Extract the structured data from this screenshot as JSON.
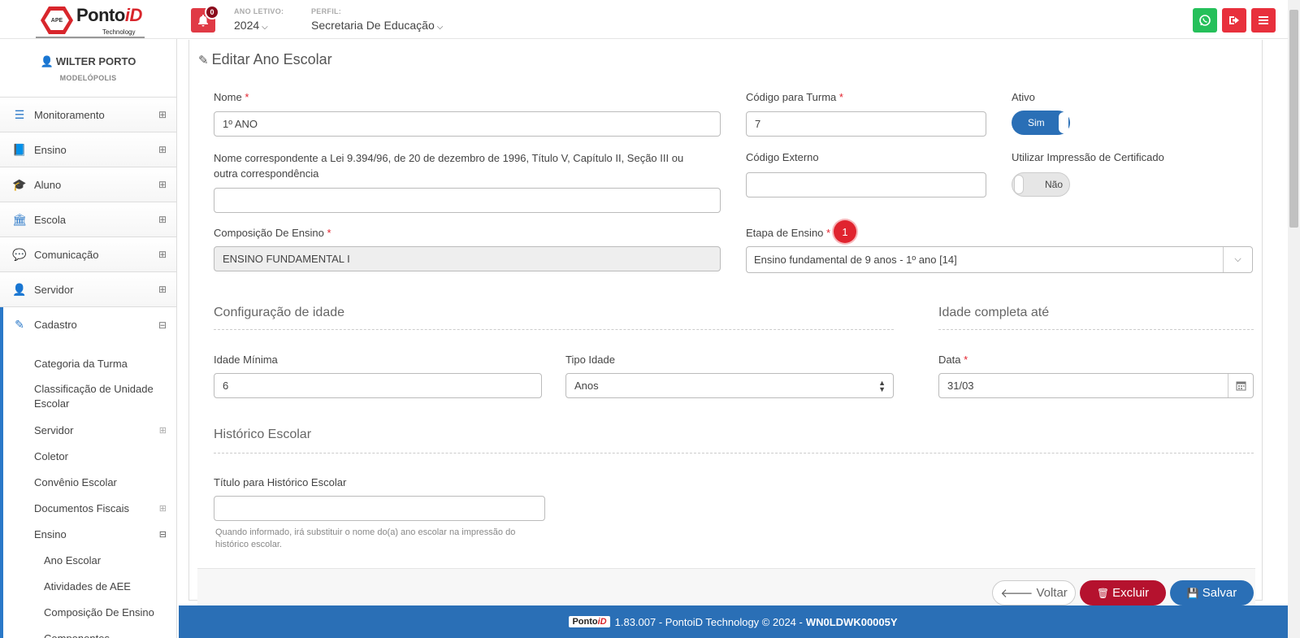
{
  "header": {
    "logo_text": "PontoiD",
    "logo_sub": "Technology",
    "logo_badge": "APE",
    "notifications_count": "0",
    "ano_letivo_label": "ANO LETIVO:",
    "ano_letivo_value": "2024",
    "perfil_label": "PERFIL:",
    "perfil_value": "Secretaria De Educação"
  },
  "user": {
    "name": "WILTER PORTO",
    "city": "MODELÓPOLIS"
  },
  "sidebar": {
    "items": [
      {
        "label": "Monitoramento"
      },
      {
        "label": "Ensino"
      },
      {
        "label": "Aluno"
      },
      {
        "label": "Escola"
      },
      {
        "label": "Comunicação"
      },
      {
        "label": "Servidor"
      },
      {
        "label": "Cadastro"
      }
    ],
    "sub_items": [
      {
        "label": "Categoria da Turma"
      },
      {
        "label": "Classificação de Unidade Escolar"
      },
      {
        "label": "Servidor"
      },
      {
        "label": "Coletor"
      },
      {
        "label": "Convênio Escolar"
      },
      {
        "label": "Documentos Fiscais"
      },
      {
        "label": "Ensino"
      }
    ],
    "deep_items": [
      {
        "label": "Ano Escolar"
      },
      {
        "label": "Atividades de AEE"
      },
      {
        "label": "Composição De Ensino"
      },
      {
        "label": "Componentes"
      }
    ]
  },
  "form": {
    "title": "Editar Ano Escolar",
    "nome_label": "Nome",
    "nome_value": "1º ANO",
    "codigo_turma_label": "Código para Turma",
    "codigo_turma_value": "7",
    "ativo_label": "Ativo",
    "ativo_value": "Sim",
    "nome_lei_label": "Nome correspondente a Lei 9.394/96, de 20 de dezembro de 1996, Título V, Capítulo II, Seção III ou outra correspondência",
    "nome_lei_value": "",
    "codigo_externo_label": "Código Externo",
    "codigo_externo_value": "",
    "certificado_label": "Utilizar Impressão de Certificado",
    "certificado_value": "Não",
    "composicao_label": "Composição De Ensino",
    "composicao_value": "ENSINO FUNDAMENTAL I",
    "etapa_label": "Etapa de Ensino",
    "etapa_badge": "1",
    "etapa_value": "Ensino fundamental de 9 anos - 1º ano [14]",
    "config_idade_title": "Configuração de idade",
    "idade_completa_title": "Idade completa até",
    "idade_minima_label": "Idade Mínima",
    "idade_minima_value": "6",
    "tipo_idade_label": "Tipo Idade",
    "tipo_idade_value": "Anos",
    "data_label": "Data",
    "data_value": "31/03",
    "historico_title": "Histórico Escolar",
    "titulo_historico_label": "Título para Histórico Escolar",
    "titulo_historico_value": "",
    "historico_hint": "Quando informado, irá substituir o nome do(a) ano escolar na impressão do histórico escolar.",
    "required_mark": "*"
  },
  "actions": {
    "voltar": "Voltar",
    "excluir": "Excluir",
    "salvar": "Salvar"
  },
  "footer": {
    "version_text": "1.83.007 - PontoiD Technology © 2024 -",
    "device_code": "WN0LDWK00005Y"
  },
  "colors": {
    "primary": "#2a6fb6",
    "danger": "#b5122e",
    "whatsapp": "#25c05a",
    "red_button": "#e8303c"
  }
}
